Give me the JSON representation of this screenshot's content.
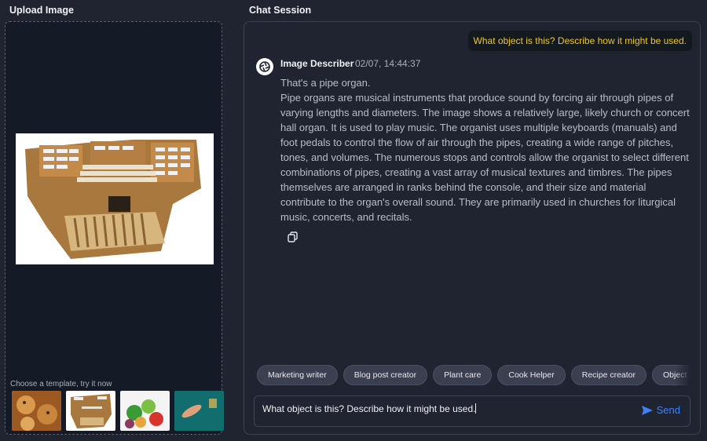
{
  "upload": {
    "title": "Upload Image",
    "template_hint": "Choose a template, try it now",
    "thumbnails": [
      "cookies",
      "pipe-organ",
      "vegetables",
      "underwater-swimmer"
    ]
  },
  "chat": {
    "title": "Chat Session",
    "user_message": "What object is this? Describe how it might be used.",
    "bot": {
      "name": "Image Describer",
      "timestamp": "02/07, 14:44:37",
      "line1": "That's a pipe organ.",
      "paragraph": "Pipe organs are musical instruments that produce sound by forcing air through pipes of varying lengths and diameters. The image shows a relatively large, likely church or concert hall organ. It is used to play music. The organist uses multiple keyboards (manuals) and foot pedals to control the flow of air through the pipes, creating a wide range of pitches, tones, and volumes. The numerous stops and controls allow the organist to select different combinations of pipes, creating a vast array of musical textures and timbres. The pipes themselves are arranged in ranks behind the console, and their size and material contribute to the organ's overall sound. They are primarily used in churches for liturgical music, concerts, and recitals."
    },
    "chips": [
      "Marketing writer",
      "Blog post creator",
      "Plant care",
      "Cook Helper",
      "Recipe creator",
      "Object identifier"
    ],
    "input_value": "What object is this? Describe how it might be used.",
    "send_label": "Send"
  },
  "colors": {
    "accent": "#3b82f6",
    "user_text": "#f3c623"
  }
}
